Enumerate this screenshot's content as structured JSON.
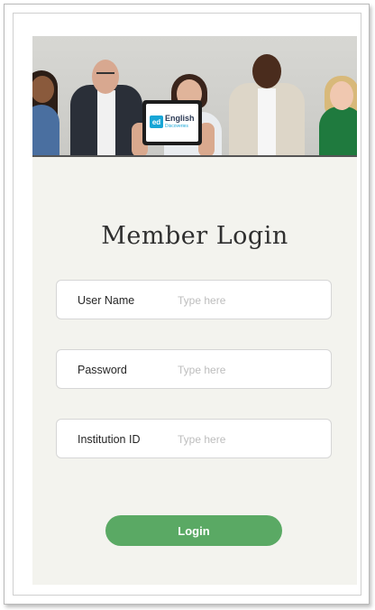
{
  "hero": {
    "tablet_logo_mark": "ed",
    "tablet_brand_line1": "English",
    "tablet_brand_line2": "Discoveries"
  },
  "login": {
    "title": "Member Login",
    "fields": [
      {
        "label": "User Name",
        "placeholder": "Type here"
      },
      {
        "label": "Password",
        "placeholder": "Type here"
      },
      {
        "label": "Institution ID",
        "placeholder": "Type here"
      }
    ],
    "submit_label": "Login"
  },
  "colors": {
    "panel_background": "#f3f3ee",
    "button_accent": "#5aa964",
    "brand_blue": "#18a6d6"
  }
}
